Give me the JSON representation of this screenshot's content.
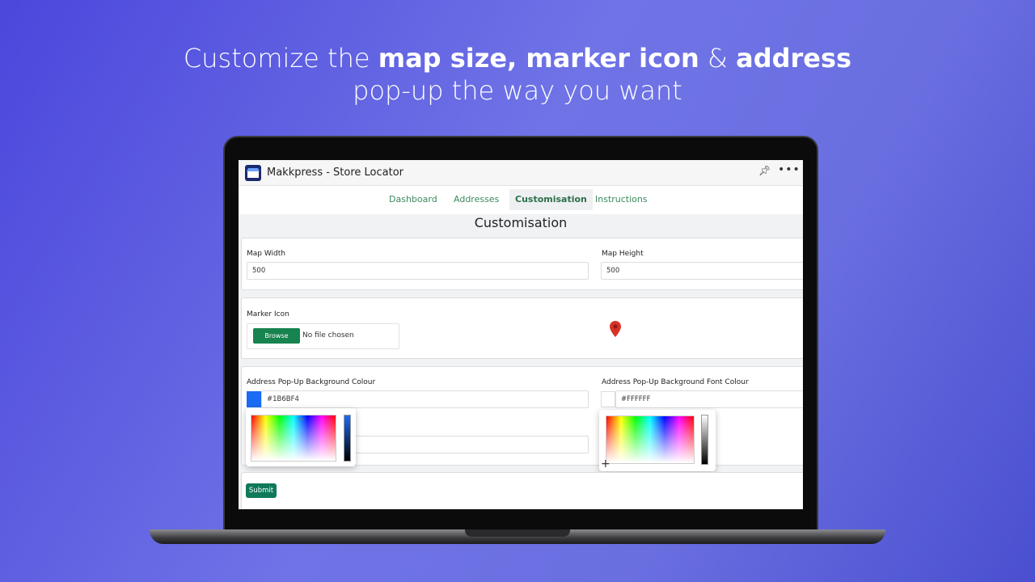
{
  "headline": {
    "line1_pre": "Customize the ",
    "bold1": "map size",
    "comma": ", ",
    "bold2": "marker icon",
    "amp": " & ",
    "bold3": "address",
    "line2": "pop-up the way you want"
  },
  "app": {
    "title": "Makkpress - Store Locator",
    "pin_icon": "pin-icon",
    "more_icon": "more-icon"
  },
  "nav": {
    "tabs": [
      {
        "label": "Dashboard"
      },
      {
        "label": "Addresses"
      },
      {
        "label": "Customisation",
        "active": true
      },
      {
        "label": "Instructions"
      }
    ]
  },
  "page": {
    "title": "Customisation"
  },
  "form": {
    "map_width_label": "Map Width",
    "map_width_value": "500",
    "map_height_label": "Map Height",
    "map_height_value": "500",
    "marker_icon_label": "Marker Icon",
    "browse_label": "Browse",
    "no_file": "No file chosen",
    "bg_colour_label": "Address Pop-Up Background Colour",
    "bg_colour_value": "#1B6BF4",
    "font_colour_label": "Address Pop-Up Background Font Colour",
    "font_colour_value": "#FFFFFF",
    "submit_label": "Submit"
  },
  "colors": {
    "accent": "#17834f",
    "marker": "#d93025",
    "bg_swatch": "#1B6BF4"
  }
}
